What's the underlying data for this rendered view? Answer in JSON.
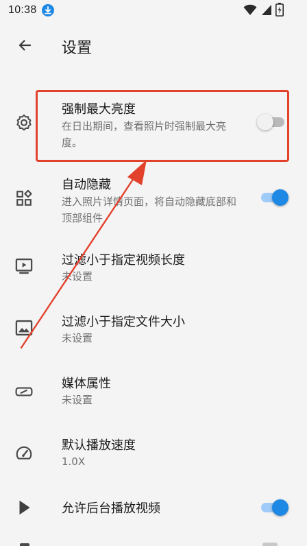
{
  "status_bar": {
    "time": "10:38",
    "icons": [
      "download-icon",
      "wifi-icon",
      "signal-icon",
      "battery-icon"
    ]
  },
  "app_bar": {
    "back_icon": "arrow-left-icon",
    "title": "设置"
  },
  "settings": {
    "force_brightness": {
      "icon": "gear-icon",
      "title": "强制最大亮度",
      "summary": "在日出期间，查看照片时强制最大亮度。",
      "enabled": false
    },
    "auto_hide": {
      "icon": "widgets-icon",
      "title": "自动隐藏",
      "summary": "进入照片详情页面，将自动隐藏底部和顶部组件",
      "enabled": true
    },
    "filter_video_length": {
      "icon": "video-icon",
      "title": "过滤小于指定视频长度",
      "summary": "未设置"
    },
    "filter_file_size": {
      "icon": "image-icon",
      "title": "过滤小于指定文件大小",
      "summary": "未设置"
    },
    "media_properties": {
      "icon": "label-icon",
      "title": "媒体属性",
      "summary": "未设置"
    },
    "playback_speed": {
      "icon": "speedometer-icon",
      "title": "默认播放速度",
      "summary": "1.0X"
    },
    "background_play": {
      "icon": "play-icon",
      "title": "允许后台播放视频",
      "enabled": true
    }
  },
  "colors": {
    "background": "#f4f4f4",
    "accent": "#1e88e5",
    "annotation": "#e2412c",
    "text_primary": "#1b1b1b",
    "text_secondary": "#6f6f6f"
  }
}
